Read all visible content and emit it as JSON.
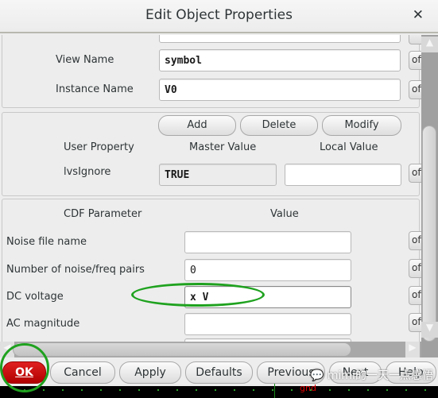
{
  "dialog": {
    "title": "Edit Object Properties",
    "close_icon": "close-icon"
  },
  "cell_section": {
    "view_name_label": "View Name",
    "view_name_value": "symbol",
    "instance_name_label": "Instance Name",
    "instance_name_value": "V0",
    "off_label": "off"
  },
  "user_props": {
    "add_label": "Add",
    "delete_label": "Delete",
    "modify_label": "Modify",
    "col_user_property": "User Property",
    "col_master_value": "Master Value",
    "col_local_value": "Local Value",
    "rows": [
      {
        "name": "lvsIgnore",
        "master": "TRUE",
        "local": ""
      }
    ]
  },
  "cdf": {
    "col_parameter": "CDF Parameter",
    "col_value": "Value",
    "params": [
      {
        "label": "Noise file name",
        "value": ""
      },
      {
        "label": "Number of noise/freq pairs",
        "value": "0"
      },
      {
        "label": "DC voltage",
        "value": "x V"
      },
      {
        "label": "AC magnitude",
        "value": ""
      }
    ]
  },
  "buttons": {
    "ok": "OK",
    "cancel": "Cancel",
    "apply": "Apply",
    "defaults": "Defaults",
    "previous": "Previous",
    "next": "Next",
    "help": "Help"
  },
  "overlay": {
    "watermark": "mimi的一天一点感悟",
    "schematic_label": "gnd",
    "annotation_color": "#1fa21f"
  }
}
